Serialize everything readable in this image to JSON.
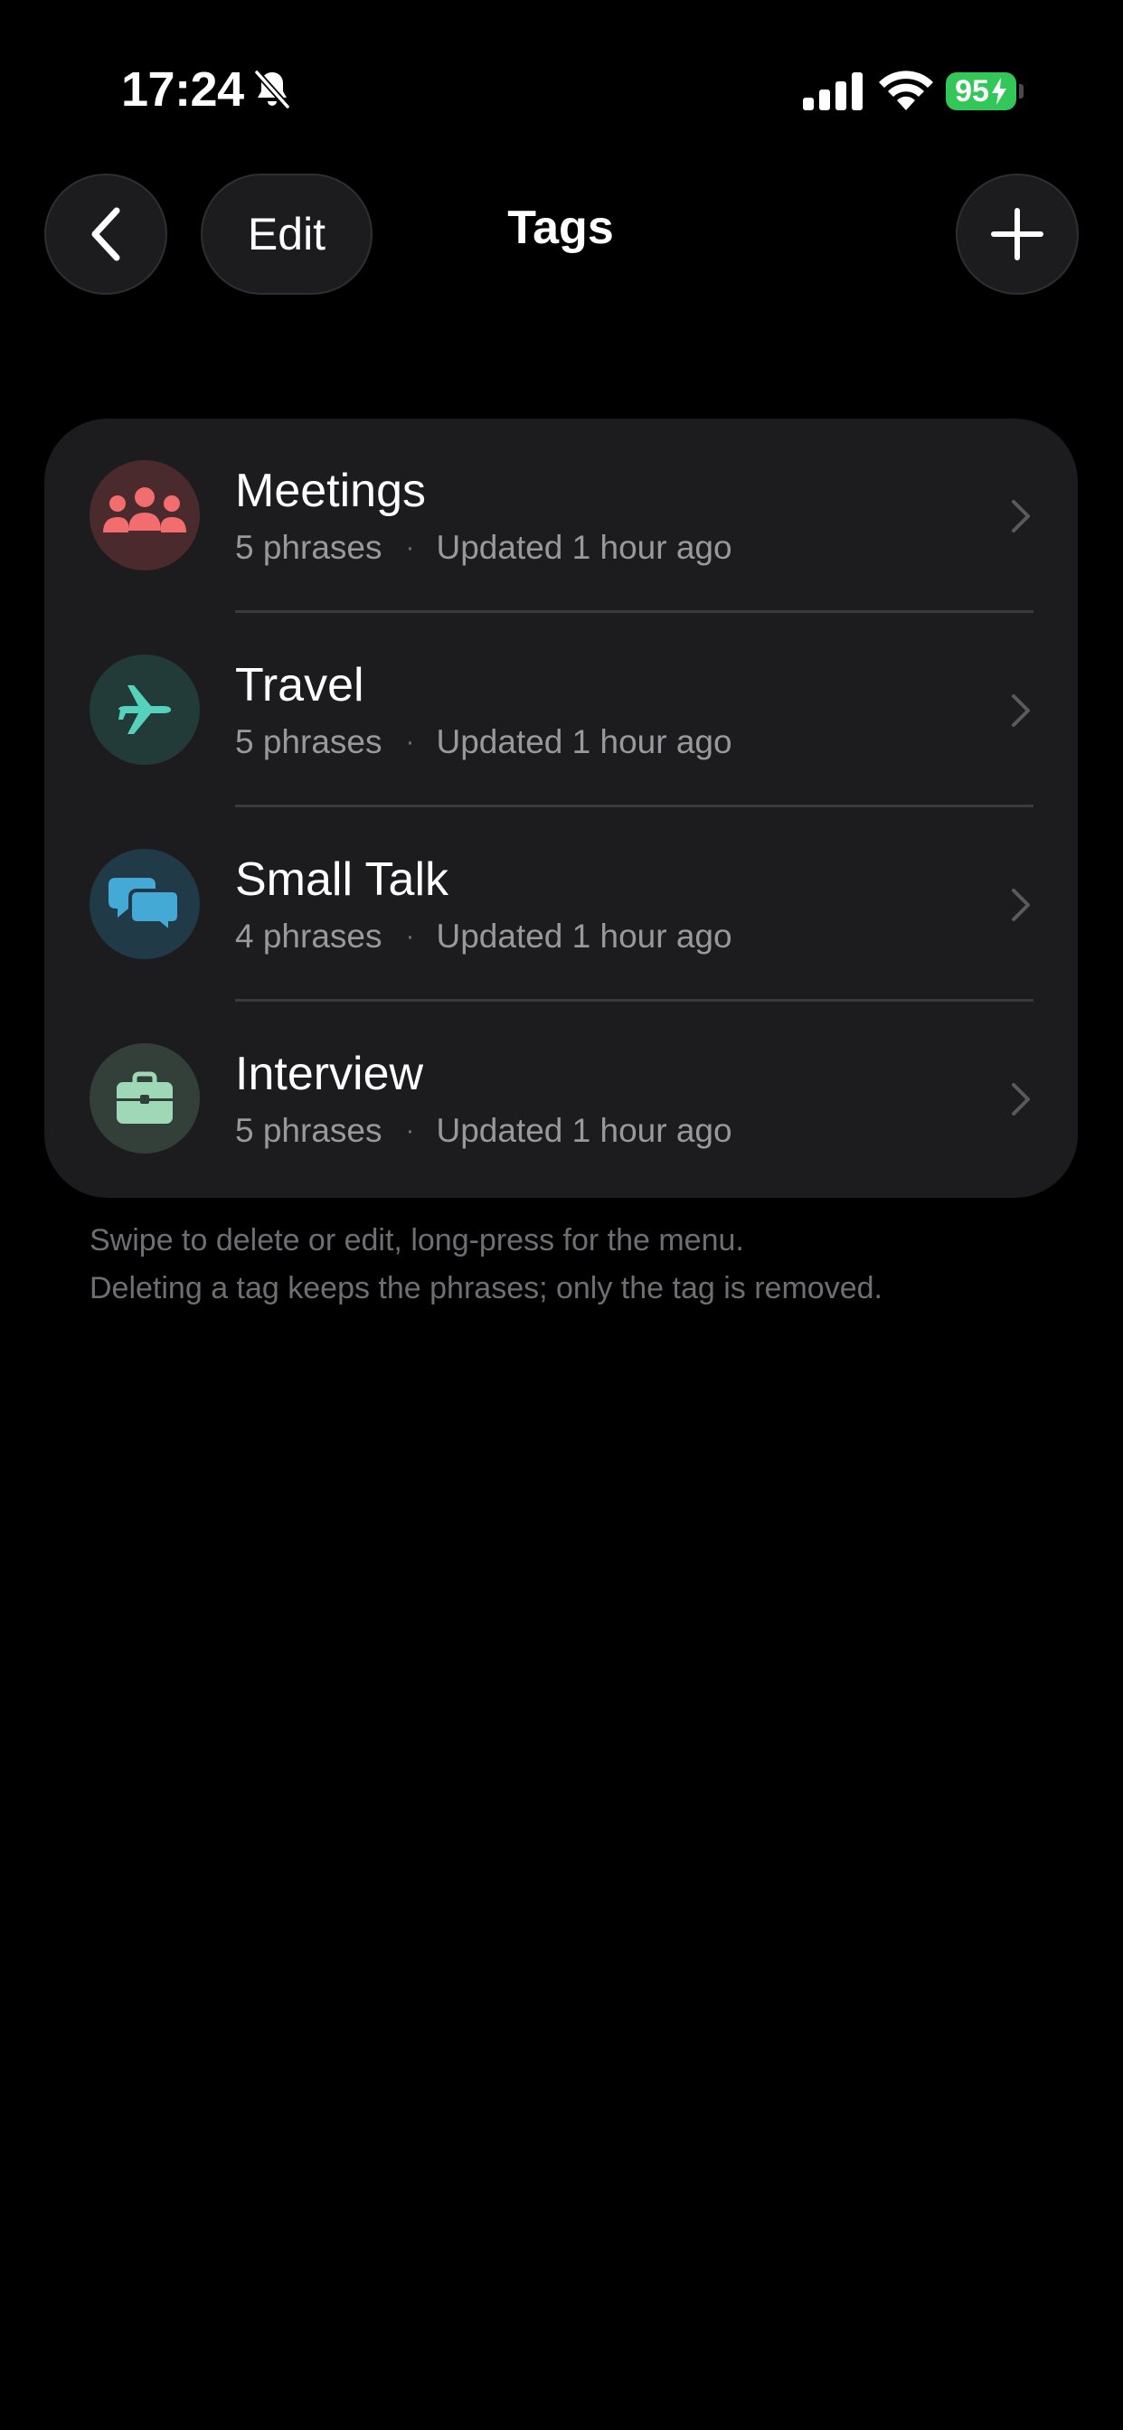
{
  "status_bar": {
    "time": "17:24",
    "battery_level": "95",
    "icons": [
      "bell-slash-icon",
      "signal-icon",
      "wifi-icon",
      "battery-charging-icon"
    ]
  },
  "nav": {
    "back_icon": "chevron-left-icon",
    "edit_label": "Edit",
    "title": "Tags",
    "add_icon": "plus-icon"
  },
  "tags": [
    {
      "name": "Meetings",
      "count": "5 phrases",
      "separator": "·",
      "updated": "Updated 1 hour ago",
      "icon": "people-icon",
      "icon_color": "#f26d6d",
      "icon_bg": "#4a2a2c"
    },
    {
      "name": "Travel",
      "count": "5 phrases",
      "separator": "·",
      "updated": "Updated 1 hour ago",
      "icon": "airplane-icon",
      "icon_color": "#56d1bd",
      "icon_bg": "#223b38"
    },
    {
      "name": "Small Talk",
      "count": "4 phrases",
      "separator": "·",
      "updated": "Updated 1 hour ago",
      "icon": "chat-bubbles-icon",
      "icon_color": "#45a9d6",
      "icon_bg": "#213a47"
    },
    {
      "name": "Interview",
      "count": "5 phrases",
      "separator": "·",
      "updated": "Updated 1 hour ago",
      "icon": "briefcase-icon",
      "icon_color": "#9ed8b6",
      "icon_bg": "#33403a"
    }
  ],
  "footer": {
    "line1": "Swipe to delete or edit, long-press for the menu.",
    "line2": "Deleting a tag keeps the phrases; only the tag is removed."
  }
}
